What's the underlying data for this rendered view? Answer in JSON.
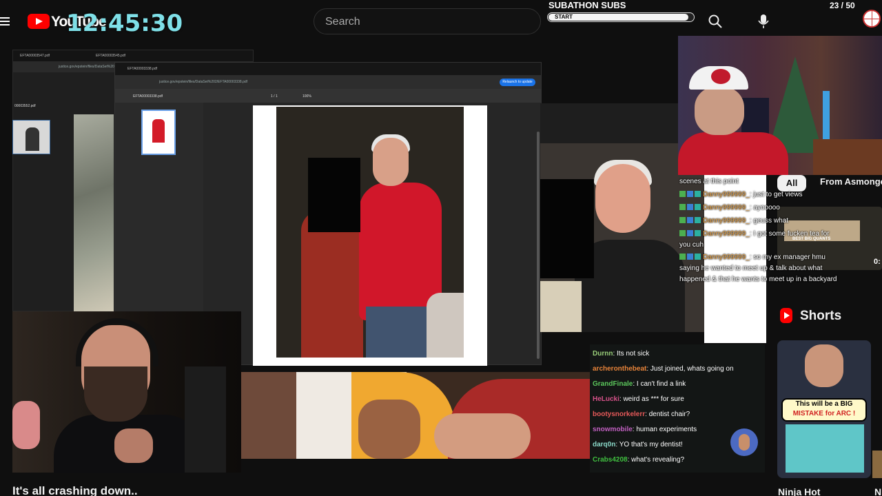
{
  "header": {
    "logo_text": "YouTube",
    "clock": "12:45:30",
    "search_placeholder": "Search"
  },
  "subathon": {
    "title": "SUBATHON SUBS",
    "progress_label": "START",
    "count": "23  / 50",
    "progress_fraction": 0.46
  },
  "browser": {
    "back_tabs": [
      "EFTA00003547.pdf",
      "EFTA00003545.pdf"
    ],
    "back_address": "justice.gov/epstein/files/DataSet%202/EFTA0000",
    "back_doc_label": "00003552.pdf",
    "front_tab": "EFTA00003338.pdf",
    "front_address": "justice.gov/epstein/files/DataSet%202/EFTA00003338.pdf",
    "update_button": "Relaunch to update",
    "pdf_title": "EFTA00003338.pdf",
    "page_indicator": "1 / 1",
    "zoom": "100%"
  },
  "chat_top": {
    "lines": [
      {
        "name": "",
        "text": "scenes at this point"
      },
      {
        "name": "Danny999999_",
        "text": ": just to get views"
      },
      {
        "name": "Danny999999_",
        "text": ": ayooooo"
      },
      {
        "name": "Danny999999_",
        "text": ": geuss what"
      },
      {
        "name": "Danny999999_",
        "text": ": I got some fucken tea for"
      },
      {
        "name": "",
        "text": "you cuh"
      },
      {
        "name": "Danny999999_",
        "text": ": so my ex manager hmu"
      },
      {
        "name": "",
        "text": "saying he wanted to meet up & talk about what"
      },
      {
        "name": "",
        "text": "happened & that he wants to meet up in a backyard"
      }
    ]
  },
  "sidebar": {
    "chip_all": "All",
    "chip_from": "From Asmongold",
    "rec_duration": "0:",
    "rec_caption": "BEST BIG QUANTS",
    "shorts_label": "Shorts",
    "short_text_1": "This will be a BIG",
    "short_text_2": "MISTAKE for ARC !",
    "short_title": "Ninja Hot",
    "short_title_2": "N"
  },
  "chat_bottom": {
    "lines": [
      {
        "name": "Durnn",
        "color": "#9ad07a",
        "text": ": Its not sick"
      },
      {
        "name": "archeronthebeat",
        "color": "#e8843a",
        "text": ": Just joined, whats going on"
      },
      {
        "name": "GrandFinale",
        "color": "#5cc85c",
        "text": ": I can't find a link"
      },
      {
        "name": "HeLucki",
        "color": "#d8528a",
        "text": ": weird as *** for sure"
      },
      {
        "name": "bootysnorkelerr",
        "color": "#e85a5a",
        "text": ": dentist chair?"
      },
      {
        "name": "snowmobile",
        "color": "#c060c0",
        "text": ": human experiments"
      },
      {
        "name": "darq0n",
        "color": "#8ad8c8",
        "text": ": YO that's my dentist!"
      },
      {
        "name": "Crabs4208",
        "color": "#40c040",
        "text": ": what's revealing?"
      }
    ]
  },
  "footer": {
    "video_title": "It's all crashing down.."
  },
  "colors": {
    "accent": "#ff0000",
    "clock": "#7fe0e8",
    "chat_name": "#e8a040"
  }
}
